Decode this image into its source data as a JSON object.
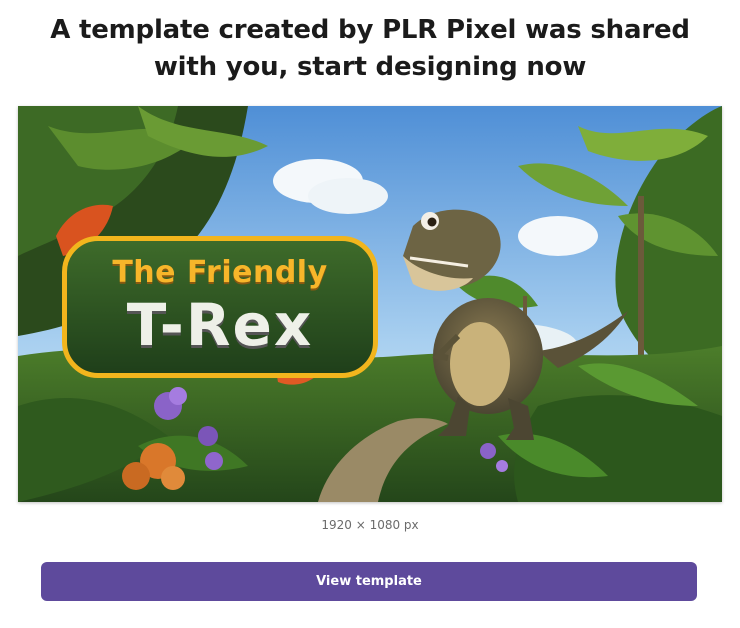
{
  "header": {
    "line1": "A template created by PLR Pixel was shared",
    "line2": "with you, start designing now"
  },
  "preview": {
    "title_line1": "The Friendly",
    "title_line2": "T-Rex",
    "dimensions": "1920 × 1080 px"
  },
  "actions": {
    "view_template_label": "View template"
  },
  "colors": {
    "button": "#5e4a9c",
    "title_accent": "#f7b62a"
  }
}
